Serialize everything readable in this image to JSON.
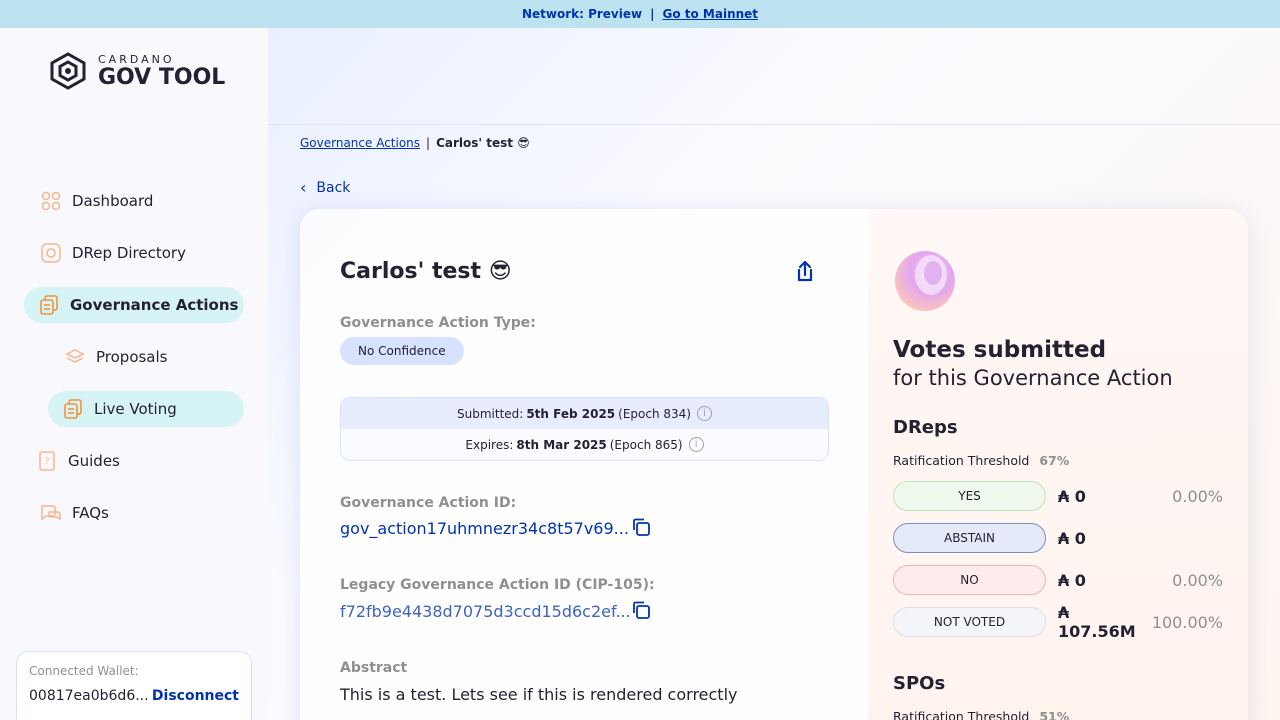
{
  "banner": {
    "network": "Network: Preview",
    "separator": "|",
    "mainnet_link": "Go to Mainnet"
  },
  "logo": {
    "small": "CARDANO",
    "big": "GOV TOOL"
  },
  "nav": {
    "dashboard": "Dashboard",
    "drep_directory": "DRep Directory",
    "governance_actions": "Governance Actions",
    "proposals": "Proposals",
    "live_voting": "Live Voting",
    "guides": "Guides",
    "faqs": "FAQs"
  },
  "wallet": {
    "label": "Connected Wallet:",
    "address": "00817ea0b6d6...",
    "disconnect": "Disconnect"
  },
  "breadcrumb": {
    "link": "Governance Actions",
    "separator": "|",
    "current": "Carlos' test 😎"
  },
  "back_label": "Back",
  "action": {
    "title": "Carlos' test 😎",
    "type_label": "Governance Action Type:",
    "type_value": "No Confidence",
    "submitted_prefix": "Submitted:",
    "submitted_date": "5th Feb 2025",
    "submitted_epoch": "(Epoch 834)",
    "expires_prefix": "Expires:",
    "expires_date": "8th Mar 2025",
    "expires_epoch": "(Epoch 865)",
    "id_label": "Governance Action ID:",
    "id_value": "gov_action17uhmnezr34c8t57v69...",
    "legacy_id_label": "Legacy Governance Action ID (CIP-105):",
    "legacy_id_value": "f72fb9e4438d7075d3ccd15d6c2ef...",
    "abstract_label": "Abstract",
    "abstract_text": "This is a test. Lets see if this is rendered correctly"
  },
  "votes": {
    "title": "Votes submitted",
    "subtitle": "for this Governance Action",
    "dreps": {
      "title": "DReps",
      "threshold_label": "Ratification Threshold",
      "threshold_value": "67%",
      "rows": [
        {
          "label": "YES",
          "amount": "₳ 0",
          "pct": "0.00%",
          "bg": "#eef8ec",
          "border": "#bfe3b9"
        },
        {
          "label": "ABSTAIN",
          "amount": "₳ 0",
          "pct": "",
          "bg": "#e4eaf8",
          "border": "#7b8fc2"
        },
        {
          "label": "NO",
          "amount": "₳ 0",
          "pct": "0.00%",
          "bg": "#fdeceb",
          "border": "#f0b4b0"
        },
        {
          "label": "NOT VOTED",
          "amount": "₳ 107.56M",
          "pct": "100.00%",
          "bg": "#f4f5f8",
          "border": "#dcdfe6"
        }
      ]
    },
    "spos": {
      "title": "SPOs",
      "threshold_label": "Ratification Threshold",
      "threshold_value": "51%"
    }
  },
  "colors": {
    "primary": "#0033ad",
    "banner": "#bde3f1",
    "active_nav": "#d6f3f5",
    "accent_orange": "#f29339"
  }
}
